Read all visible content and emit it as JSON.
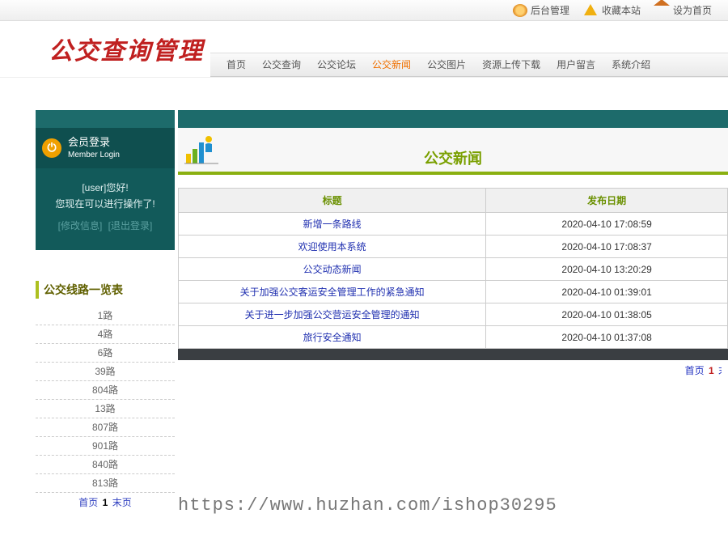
{
  "topbar": {
    "admin": "后台管理",
    "favorite": "收藏本站",
    "sethome": "设为首页"
  },
  "logo": "公交查询管理",
  "nav": {
    "items": [
      {
        "label": "首页",
        "active": false
      },
      {
        "label": "公交查询",
        "active": false
      },
      {
        "label": "公交论坛",
        "active": false
      },
      {
        "label": "公交新闻",
        "active": true
      },
      {
        "label": "公交图片",
        "active": false
      },
      {
        "label": "资源上传下载",
        "active": false
      },
      {
        "label": "用户留言",
        "active": false
      },
      {
        "label": "系统介绍",
        "active": false
      }
    ]
  },
  "login": {
    "title_cn": "会员登录",
    "title_en": "Member Login",
    "greeting1": "[user]您好!",
    "greeting2": "您现在可以进行操作了!",
    "modify": "[修改信息]",
    "logout": "[退出登录]"
  },
  "routes": {
    "title": "公交线路一览表",
    "items": [
      "1路",
      "4路",
      "6路",
      "39路",
      "804路",
      "13路",
      "807路",
      "901路",
      "840路",
      "813路"
    ],
    "pager_first": "首页",
    "pager_current": "1",
    "pager_last": "末页"
  },
  "content": {
    "title": "公交新闻",
    "col_title": "标题",
    "col_date": "发布日期",
    "rows": [
      {
        "title": "新增一条路线",
        "date": "2020-04-10 17:08:59"
      },
      {
        "title": "欢迎使用本系统",
        "date": "2020-04-10 17:08:37"
      },
      {
        "title": "公交动态新闻",
        "date": "2020-04-10 13:20:29"
      },
      {
        "title": "关于加强公交客运安全管理工作的紧急通知",
        "date": "2020-04-10 01:39:01"
      },
      {
        "title": "关于进一步加强公交营运安全管理的通知",
        "date": "2020-04-10 01:38:05"
      },
      {
        "title": "旅行安全通知",
        "date": "2020-04-10 01:37:08"
      }
    ],
    "pager_first": "首页",
    "pager_current": "1",
    "pager_last": "末页"
  },
  "watermark": "https://www.huzhan.com/ishop30295"
}
